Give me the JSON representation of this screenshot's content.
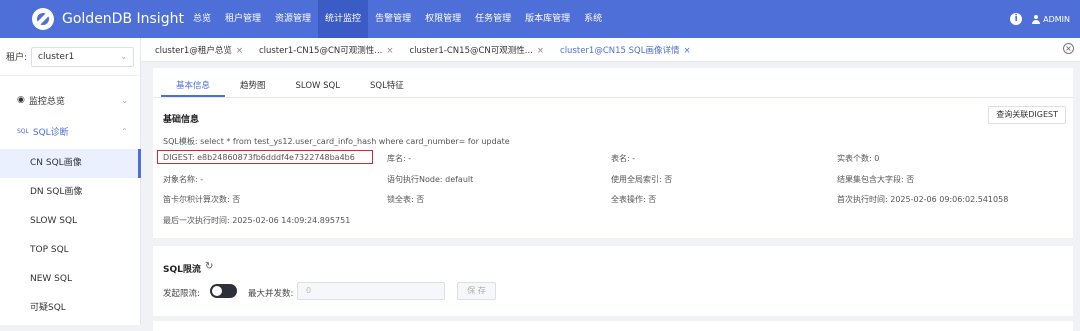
{
  "app": {
    "title": "GoldenDB Insight",
    "user": "ADMIN"
  },
  "nav": {
    "items": [
      "总览",
      "租户管理",
      "资源管理",
      "统计监控",
      "告警管理",
      "权限管理",
      "任务管理",
      "版本库管理",
      "系统"
    ],
    "active_index": 3
  },
  "sidebar": {
    "tenant_label": "租户:",
    "tenant_value": "cluster1",
    "groups": [
      {
        "label": "监控总览",
        "icon": "eye-icon",
        "expanded": false
      },
      {
        "label": "SQL诊断",
        "icon": "sql-icon",
        "icon_text": "SQL",
        "expanded": true
      }
    ],
    "sub_items": [
      "CN SQL画像",
      "DN SQL画像",
      "SLOW SQL",
      "TOP SQL",
      "NEW SQL",
      "可疑SQL"
    ],
    "active_sub_index": 0
  },
  "tabs": [
    {
      "label": "cluster1@租户总览",
      "close": "×"
    },
    {
      "label": "cluster1-CN15@CN可观测性...",
      "close": "×"
    },
    {
      "label": "cluster1-CN15@CN可观测性...",
      "close": "×"
    },
    {
      "label": "cluster1@CN15 SQL画像详情",
      "close": "×",
      "active": true
    }
  ],
  "close_all": "×",
  "sub_tabs": [
    "基本信息",
    "趋势图",
    "SLOW SQL",
    "SQL特征"
  ],
  "basic": {
    "title": "基础信息",
    "digest_button": "查询关联DIGEST",
    "sql_template": "SQL模板: select * from test_ys12.user_card_info_hash where card_number= for update",
    "digest": "DIGEST: e8b24860873fb6dddf4e7322748ba4b6",
    "db_name": "库名: -",
    "table_name": "表名: -",
    "actual_tables": "实表个数: 0",
    "object_name": "对象名称: -",
    "exec_node": "语句执行Node: default",
    "use_full_index": "使用全局索引: 否",
    "result_big_field": "结果集包含大字段: 否",
    "cartesian": "笛卡尔积计算次数: 否",
    "lock_table": "锁全表: 否",
    "full_table_op": "全表操作: 否",
    "first_exec": "首次执行时间: 2025-02-06 09:06:02.541058",
    "last_exec": "最后一次执行时间: 2025-02-06 14:09:24.895751",
    "highlight_color": "#d9262c"
  },
  "flow": {
    "title": "SQL限流",
    "toggle_label": "发起限流:",
    "toggle_on": false,
    "concurrency_label": "最大并发数:",
    "concurrency_placeholder": "0",
    "save_label": "保 存"
  },
  "colors": {
    "accent": "#4e6fd8",
    "topbar": "#4e6fd8",
    "active_nav": "#3b5bc5"
  }
}
